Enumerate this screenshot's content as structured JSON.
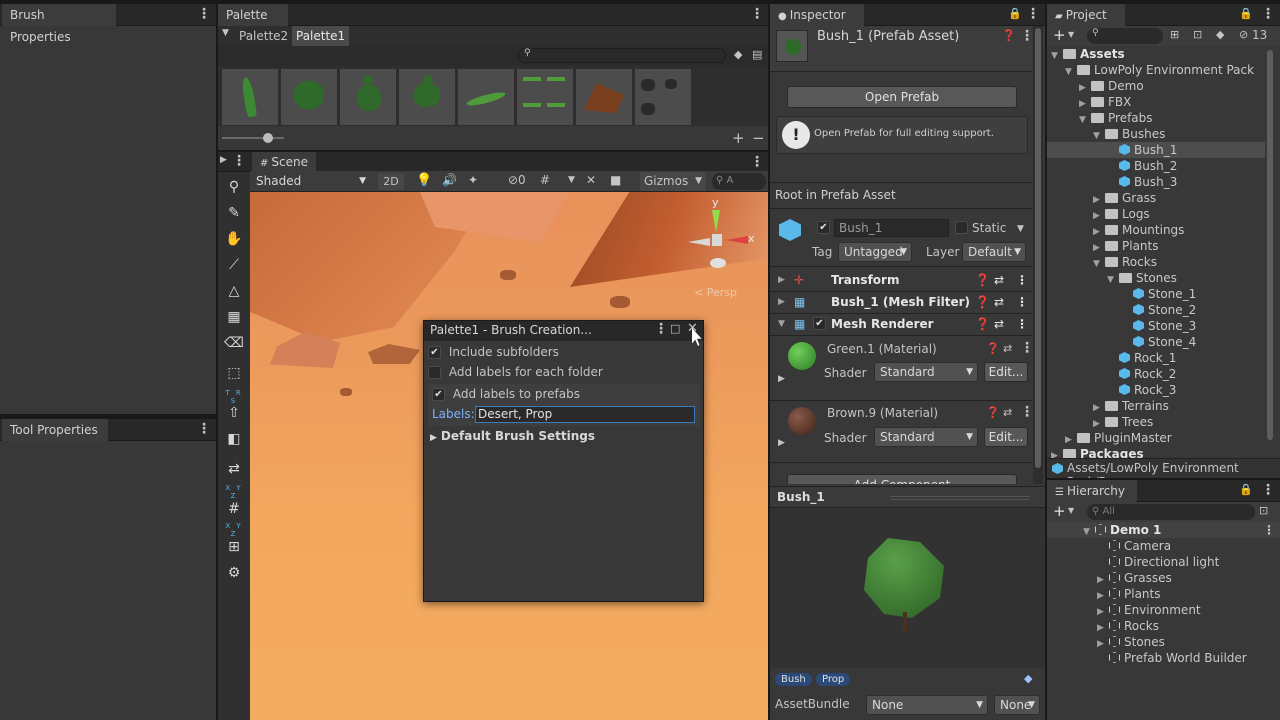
{
  "brush_properties": {
    "tab": "Brush Properties"
  },
  "tool_properties": {
    "tab": "Tool Properties"
  },
  "palette": {
    "tab": "Palette",
    "subtabs": [
      "Palette2",
      "Palette1"
    ],
    "search_placeholder": ""
  },
  "scene": {
    "tab": "Scene",
    "shading": "Shaded",
    "mode_2d": "2D",
    "gizmos": "Gizmos",
    "search_hint": "A",
    "persp": "< Persp",
    "gizmo_axes": {
      "x": "x",
      "y": "y"
    }
  },
  "toolbar": {
    "trs": "T R S",
    "xyz1": "X Y Z",
    "xyz2": "X Y Z"
  },
  "dialog": {
    "title": "Palette1 - Brush Creation...",
    "include_subfolders": "Include subfolders",
    "add_labels_folder": "Add labels for each folder",
    "add_labels_prefabs": "Add labels to prefabs",
    "labels_label": "Labels:",
    "labels_value": "Desert, Prop",
    "default_brush_settings": "Default Brush Settings"
  },
  "inspector": {
    "tab": "Inspector",
    "asset_title": "Bush_1 (Prefab Asset)",
    "open_prefab": "Open Prefab",
    "info": "Open Prefab for full editing support.",
    "root_label": "Root in Prefab Asset",
    "name_field": "Bush_1",
    "static": "Static",
    "tag_label": "Tag",
    "tag_value": "Untagged",
    "layer_label": "Layer",
    "layer_value": "Default",
    "components": [
      "Transform",
      "Bush_1 (Mesh Filter)",
      "Mesh Renderer"
    ],
    "materials": [
      {
        "name": "Green.1 (Material)",
        "shader_label": "Shader",
        "shader": "Standard",
        "edit": "Edit...",
        "color": "#3f8f3a"
      },
      {
        "name": "Brown.9 (Material)",
        "shader_label": "Shader",
        "shader": "Standard",
        "edit": "Edit...",
        "color": "#5a3a2e"
      }
    ],
    "add_component": "Add Component",
    "preview_title": "Bush_1",
    "labels": [
      "Bush",
      "Prop"
    ],
    "asset_bundle_label": "AssetBundle",
    "asset_bundle_value": "None",
    "asset_bundle_variant": "None"
  },
  "project": {
    "tab": "Project",
    "hidden_count": "13",
    "path": "Assets/LowPoly Environment Pack/P",
    "tree": [
      {
        "label": "Assets",
        "depth": 0,
        "icon": "folder",
        "fold": "open",
        "bold": true
      },
      {
        "label": "LowPoly Environment Pack",
        "depth": 1,
        "icon": "folder",
        "fold": "open"
      },
      {
        "label": "Demo",
        "depth": 2,
        "icon": "folder",
        "fold": "closed"
      },
      {
        "label": "FBX",
        "depth": 2,
        "icon": "folder",
        "fold": "closed"
      },
      {
        "label": "Prefabs",
        "depth": 2,
        "icon": "folder",
        "fold": "open"
      },
      {
        "label": "Bushes",
        "depth": 3,
        "icon": "folder",
        "fold": "open"
      },
      {
        "label": "Bush_1",
        "depth": 4,
        "icon": "cube",
        "fold": "",
        "selected": true
      },
      {
        "label": "Bush_2",
        "depth": 4,
        "icon": "cube",
        "fold": ""
      },
      {
        "label": "Bush_3",
        "depth": 4,
        "icon": "cube",
        "fold": ""
      },
      {
        "label": "Grass",
        "depth": 3,
        "icon": "folder",
        "fold": "closed"
      },
      {
        "label": "Logs",
        "depth": 3,
        "icon": "folder",
        "fold": "closed"
      },
      {
        "label": "Mountings",
        "depth": 3,
        "icon": "folder",
        "fold": "closed"
      },
      {
        "label": "Plants",
        "depth": 3,
        "icon": "folder",
        "fold": "closed"
      },
      {
        "label": "Rocks",
        "depth": 3,
        "icon": "folder",
        "fold": "open"
      },
      {
        "label": "Stones",
        "depth": 4,
        "icon": "folder",
        "fold": "open"
      },
      {
        "label": "Stone_1",
        "depth": 5,
        "icon": "cube",
        "fold": ""
      },
      {
        "label": "Stone_2",
        "depth": 5,
        "icon": "cube",
        "fold": ""
      },
      {
        "label": "Stone_3",
        "depth": 5,
        "icon": "cube",
        "fold": ""
      },
      {
        "label": "Stone_4",
        "depth": 5,
        "icon": "cube",
        "fold": ""
      },
      {
        "label": "Rock_1",
        "depth": 4,
        "icon": "cube",
        "fold": ""
      },
      {
        "label": "Rock_2",
        "depth": 4,
        "icon": "cube",
        "fold": ""
      },
      {
        "label": "Rock_3",
        "depth": 4,
        "icon": "cube",
        "fold": ""
      },
      {
        "label": "Terrains",
        "depth": 3,
        "icon": "folder",
        "fold": "closed"
      },
      {
        "label": "Trees",
        "depth": 3,
        "icon": "folder",
        "fold": "closed"
      },
      {
        "label": "PluginMaster",
        "depth": 1,
        "icon": "folder",
        "fold": "closed"
      },
      {
        "label": "Packages",
        "depth": 0,
        "icon": "folder",
        "fold": "closed",
        "bold": true
      }
    ]
  },
  "hierarchy": {
    "tab": "Hierarchy",
    "search_placeholder": "All",
    "items": [
      {
        "label": "Demo 1",
        "depth": 0,
        "fold": "open",
        "bold": true
      },
      {
        "label": "Camera",
        "depth": 1,
        "fold": ""
      },
      {
        "label": "Directional light",
        "depth": 1,
        "fold": ""
      },
      {
        "label": "Grasses",
        "depth": 1,
        "fold": "closed"
      },
      {
        "label": "Plants",
        "depth": 1,
        "fold": "closed"
      },
      {
        "label": "Environment",
        "depth": 1,
        "fold": "closed"
      },
      {
        "label": "Rocks",
        "depth": 1,
        "fold": "closed"
      },
      {
        "label": "Stones",
        "depth": 1,
        "fold": "closed"
      },
      {
        "label": "Prefab World Builder",
        "depth": 1,
        "fold": ""
      }
    ]
  }
}
